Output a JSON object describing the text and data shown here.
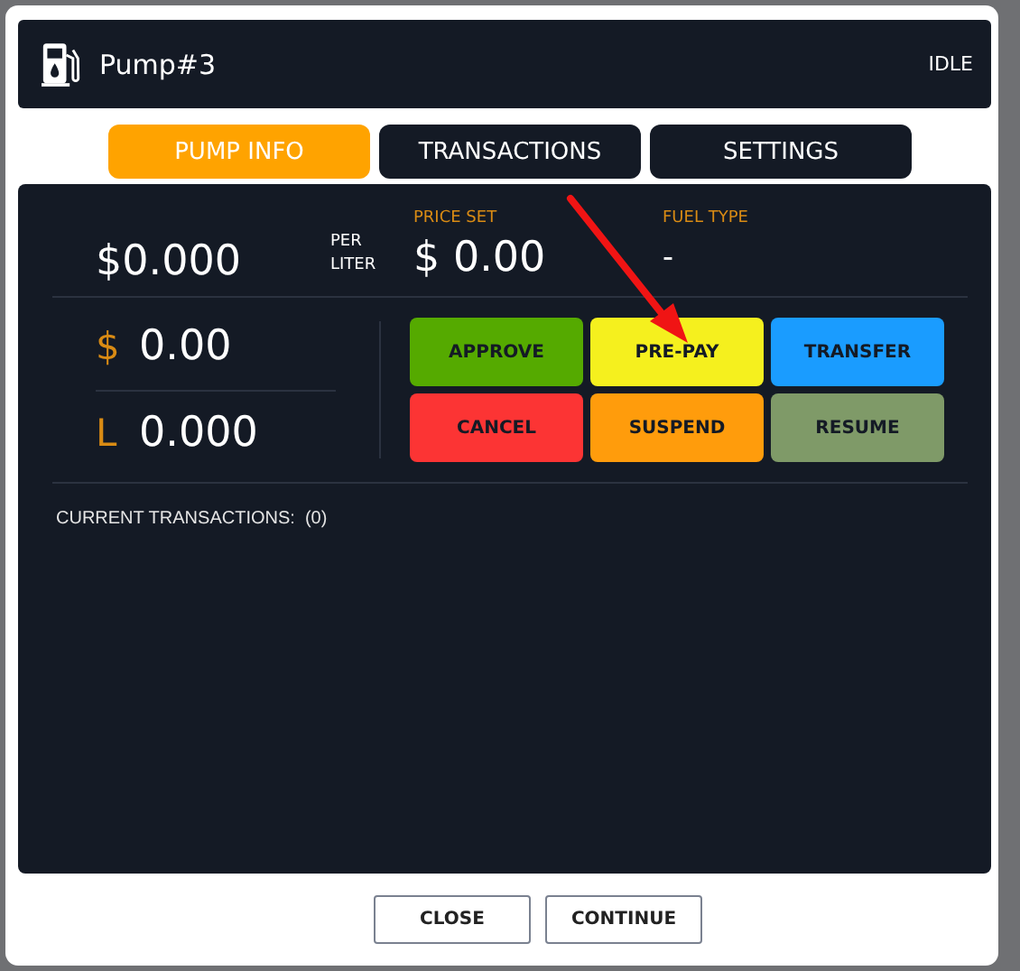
{
  "window": {
    "title": "Pump#3",
    "status": "IDLE"
  },
  "tabs": [
    {
      "label": "PUMP INFO",
      "selected": true
    },
    {
      "label": "TRANSACTIONS",
      "selected": false
    },
    {
      "label": "SETTINGS",
      "selected": false
    }
  ],
  "price": {
    "value": "$0.000",
    "unit_top": "PER",
    "unit_bottom": "LITER"
  },
  "price_set": {
    "label": "PRICE SET",
    "value": "$ 0.00"
  },
  "fuel_type": {
    "label": "FUEL TYPE",
    "value": "-"
  },
  "totals": [
    {
      "symbol": "$",
      "value": "0.00"
    },
    {
      "symbol": "L",
      "value": "0.000"
    }
  ],
  "actions": [
    {
      "label": "APPROVE",
      "color": "#55aa00"
    },
    {
      "label": "PRE-PAY",
      "color": "#f5f01e"
    },
    {
      "label": "TRANSFER",
      "color": "#1a9cff"
    },
    {
      "label": "CANCEL",
      "color": "#fc3434"
    },
    {
      "label": "SUSPEND",
      "color": "#ff9c0c"
    },
    {
      "label": "RESUME",
      "color": "#7f9a68"
    }
  ],
  "current_transactions": {
    "label": "CURRENT TRANSACTIONS:",
    "count": "(0)"
  },
  "buttons": [
    "CLOSE",
    "CONTINUE"
  ]
}
